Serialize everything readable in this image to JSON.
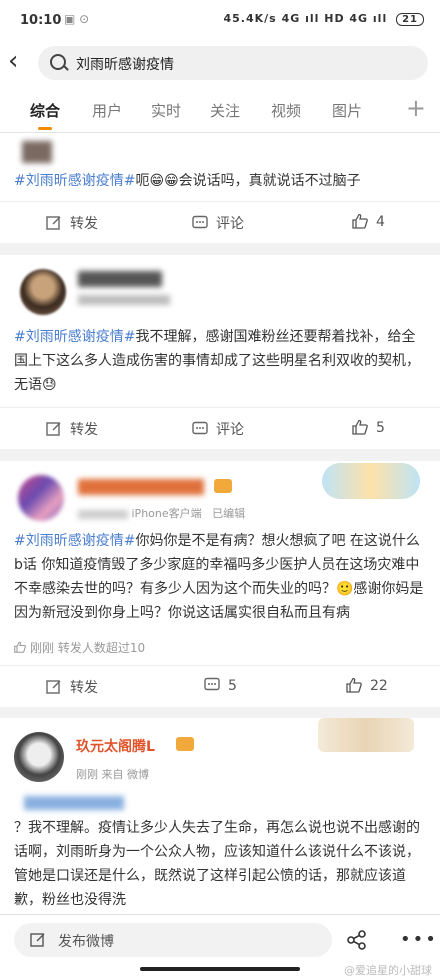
{
  "status_bar": {
    "time": "10:10",
    "speed": "45.4K/s",
    "network": "4G ıll HD 4G ıll",
    "battery": "21"
  },
  "search": {
    "query": "刘雨昕感谢疫情"
  },
  "tabs": [
    "综合",
    "用户",
    "实时",
    "关注",
    "视频",
    "图片"
  ],
  "tab_plus": "+",
  "posts": [
    {
      "hashtag": "#刘雨昕感谢疫情#",
      "text": "呃😁😁会说话吗，真就说话不过脑子",
      "repost_label": "转发",
      "comment_label": "评论",
      "like_count": "4"
    },
    {
      "hashtag": "#刘雨昕感谢疫情#",
      "text": "我不理解，感谢国难粉丝还要帮着找补，给全国上下这么多人造成伤害的事情却成了这些明星名利双收的契机，无语😓",
      "repost_label": "转发",
      "comment_label": "评论",
      "like_count": "5"
    },
    {
      "source": "iPhone客户端",
      "edited": "已编辑",
      "hashtag": "#刘雨昕感谢疫情#",
      "text": "你妈你是不是有病？想火想疯了吧 在这说什么b话 你知道疫情毁了多少家庭的幸福吗多少医护人员在这场灾难中不幸感染去世的吗？有多少人因为这个而失业的吗？🙂感谢你妈是因为新冠没到你身上吗？你说这话属实很自私而且有病",
      "repost_note": "刚刚 转发人数超过10",
      "repost_label": "转发",
      "comment_count": "5",
      "like_count": "22"
    },
    {
      "username": "玖元太阁腾L",
      "meta": "刚刚  来自 微博",
      "text": "？我不理解。疫情让多少人失去了生命，再怎么说也说不出感谢的话啊，刘雨昕身为一个公众人物，应该知道什么该说什么不该说，管她是口误还是什么，既然说了这样引起公愤的话，那就应该道歉，粉丝也没得洗"
    }
  ],
  "bottom": {
    "compose_label": "发布微博"
  },
  "watermark": "@爱追星的小甜球",
  "colors": {
    "accent": "#f28b00",
    "hashtag": "#4a7ecf"
  }
}
